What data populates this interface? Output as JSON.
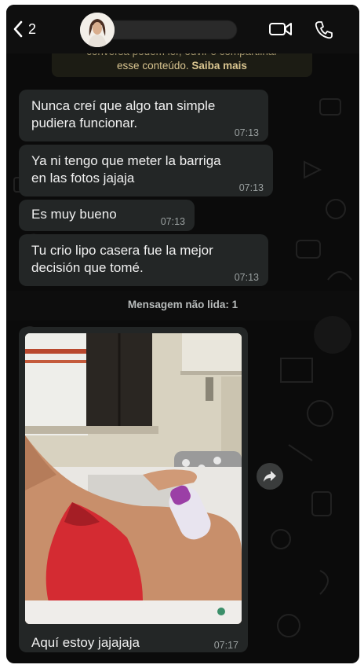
{
  "header": {
    "back_count": "2"
  },
  "notice": {
    "line1": "conversa podem ler, ouvir e compartilhar",
    "line2_text": "esse conteúdo.",
    "link": "Saiba mais"
  },
  "messages": [
    {
      "line1": "Nunca creí que algo tan simple",
      "line2": "pudiera funcionar.",
      "time": "07:13"
    },
    {
      "line1": "Ya ni tengo que meter la barriga",
      "line2": "en las fotos jajaja",
      "time": "07:13"
    },
    {
      "line1": "Es muy bueno",
      "line2": "",
      "time": "07:13"
    },
    {
      "line1": "Tu crio lipo casera fue la mejor",
      "line2": "decisión que tomé.",
      "time": "07:13"
    }
  ],
  "unread_label": "Mensagem não lida: 1",
  "media_message": {
    "caption": "Aquí estoy jajajaja",
    "time": "07:17"
  },
  "icons": {
    "back": "chevron-left-icon",
    "video": "video-camera-icon",
    "call": "phone-icon",
    "forward": "forward-arrow-icon"
  },
  "colors": {
    "background": "#0b0b0b",
    "bubble": "#232626",
    "notice_text": "#d9c590"
  }
}
